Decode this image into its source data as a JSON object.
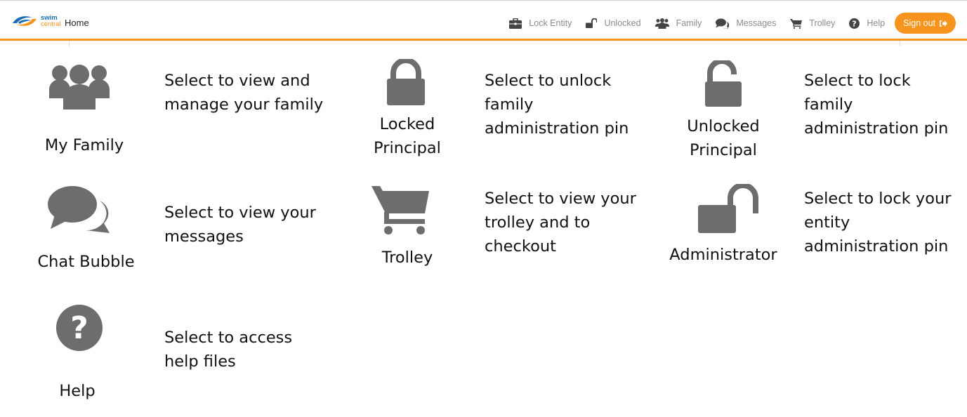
{
  "header": {
    "logo": {
      "line1": "swim",
      "line2": "central",
      "icon": "swim-central-logo-icon"
    },
    "home_label": "Home",
    "nav": {
      "lock_entity": {
        "label": "Lock Entity",
        "icon": "briefcase-icon"
      },
      "unlocked": {
        "label": "Unlocked",
        "icon": "unlock-icon"
      },
      "family": {
        "label": "Family",
        "icon": "users-icon"
      },
      "messages": {
        "label": "Messages",
        "icon": "comments-icon"
      },
      "trolley": {
        "label": "Trolley",
        "icon": "cart-icon"
      },
      "help": {
        "label": "Help",
        "icon": "question-circle-icon"
      }
    },
    "signout_label": "Sign out",
    "accent_color": "#f7941d"
  },
  "tiles": {
    "my_family": {
      "label": "My Family",
      "description": "Select to view and manage your family",
      "icon": "users-icon"
    },
    "locked_principal": {
      "label_line1": "Locked",
      "label_line2": "Principal",
      "description": "Select to unlock family administration pin",
      "icon": "lock-icon"
    },
    "unlocked_principal": {
      "label_line1": "Unlocked",
      "label_line2": "Principal",
      "description": "Select to lock family administration pin",
      "icon": "unlock-icon"
    },
    "chat_bubble": {
      "label": "Chat Bubble",
      "description": "Select to view your messages",
      "icon": "comments-icon"
    },
    "trolley": {
      "label": "Trolley",
      "description": "Select to view your trolley and to checkout",
      "icon": "cart-icon"
    },
    "administrator": {
      "label": "Administrator",
      "description": "Select to lock your entity administration pin",
      "icon": "unlock-alt-icon"
    },
    "help": {
      "label": "Help",
      "description": "Select to access help files",
      "icon": "question-circle-icon"
    }
  },
  "icon_color": "#6d6d6d"
}
